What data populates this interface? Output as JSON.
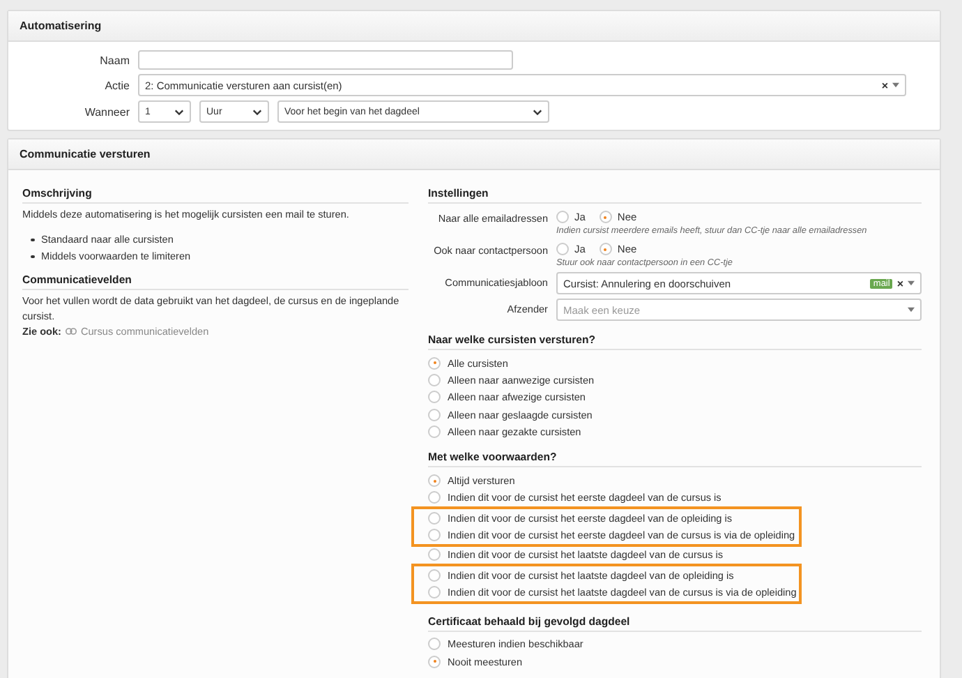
{
  "automation": {
    "title": "Automatisering",
    "naam": {
      "label": "Naam"
    },
    "actie": {
      "label": "Actie",
      "value": "2: Communicatie versturen aan cursist(en)",
      "clear": "×"
    },
    "wanneer": {
      "label": "Wanneer",
      "selects": [
        "1",
        "Uur",
        "Voor het begin van het dagdeel"
      ]
    }
  },
  "communication": {
    "title": "Communicatie versturen",
    "description": {
      "heading": "Omschrijving",
      "text": "Middels deze automatisering is het mogelijk cursisten een mail te sturen.",
      "bullets": [
        "Standaard naar alle cursisten",
        "Middels voorwaarden te limiteren"
      ]
    },
    "fields_info": {
      "heading": "Communicatievelden",
      "text": "Voor het vullen wordt de data gebruikt van het dagdeel, de cursus en de ingeplande cursist.",
      "see_also": "Zie ook:",
      "link": "Cursus communicatievelden"
    },
    "settings": {
      "heading": "Instellingen",
      "rows": [
        {
          "kind": "radio",
          "label": "Naar alle emailadressen",
          "options": [
            {
              "label": "Ja",
              "selected": false
            },
            {
              "label": "Nee",
              "selected": true
            }
          ],
          "hint": "Indien cursist meerdere emails heeft, stuur dan CC-tje naar alle emailadressen"
        },
        {
          "kind": "radio",
          "label": "Ook naar contactpersoon",
          "options": [
            {
              "label": "Ja",
              "selected": false
            },
            {
              "label": "Nee",
              "selected": true
            }
          ],
          "hint": "Stuur ook naar contactpersoon in een CC-tje"
        },
        {
          "kind": "select",
          "label": "Communicatiesjabloon",
          "value": "Cursist: Annulering en doorschuiven",
          "tag": "mail",
          "clear": "×"
        },
        {
          "kind": "select",
          "label": "Afzender",
          "placeholder": "Maak een keuze"
        }
      ]
    },
    "groups": [
      {
        "heading": "Naar welke cursisten versturen?",
        "options": [
          {
            "label": "Alle cursisten",
            "selected": true,
            "highlighted": false
          },
          {
            "label": "Alleen naar aanwezige cursisten",
            "selected": false,
            "highlighted": false
          },
          {
            "label": "Alleen naar afwezige cursisten",
            "selected": false,
            "highlighted": false
          },
          {
            "label": "Alleen naar geslaagde cursisten",
            "selected": false,
            "highlighted": false
          },
          {
            "label": "Alleen naar gezakte cursisten",
            "selected": false,
            "highlighted": false
          }
        ]
      },
      {
        "heading": "Met welke voorwaarden?",
        "options": [
          {
            "label": "Altijd versturen",
            "selected": true,
            "highlighted": false
          },
          {
            "label": "Indien dit voor de cursist het eerste dagdeel van de cursus is",
            "selected": false,
            "highlighted": false
          },
          {
            "label": "Indien dit voor de cursist het eerste dagdeel van de opleiding is",
            "selected": false,
            "highlighted": true
          },
          {
            "label": "Indien dit voor de cursist het eerste dagdeel van de cursus is via de opleiding",
            "selected": false,
            "highlighted": true
          },
          {
            "label": "Indien dit voor de cursist het laatste dagdeel van de cursus is",
            "selected": false,
            "highlighted": false
          },
          {
            "label": "Indien dit voor de cursist het laatste dagdeel van de opleiding is",
            "selected": false,
            "highlighted": true
          },
          {
            "label": "Indien dit voor de cursist het laatste dagdeel van de cursus is via de opleiding",
            "selected": false,
            "highlighted": true
          }
        ]
      },
      {
        "heading": "Certificaat behaald bij gevolgd dagdeel",
        "options": [
          {
            "label": "Meesturen indien beschikbaar",
            "selected": false,
            "highlighted": false
          },
          {
            "label": "Nooit meesturen",
            "selected": true,
            "highlighted": false
          }
        ]
      }
    ]
  }
}
